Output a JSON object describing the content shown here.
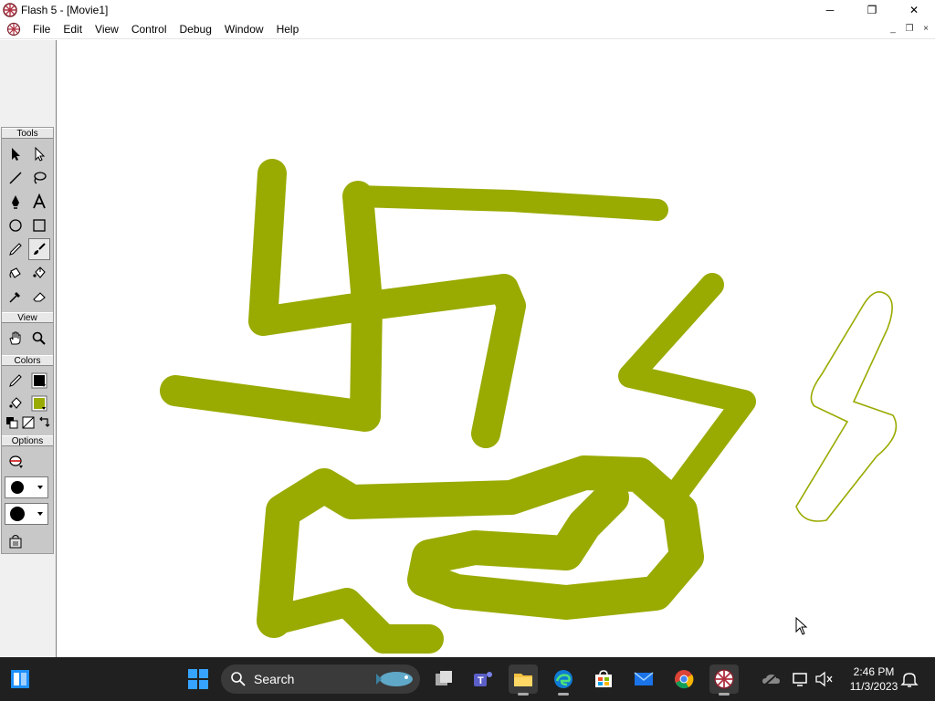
{
  "window": {
    "title": "Flash 5 - [Movie1]",
    "minimize_glyph": "─",
    "maximize_glyph": "❐",
    "close_glyph": "✕",
    "mdi_minimize_glyph": "_",
    "mdi_restore_glyph": "❐",
    "mdi_close_glyph": "×"
  },
  "menu": {
    "items": [
      "File",
      "Edit",
      "View",
      "Control",
      "Debug",
      "Window",
      "Help"
    ]
  },
  "toolbox": {
    "sections": {
      "tools": "Tools",
      "view": "View",
      "colors": "Colors",
      "options": "Options"
    },
    "tools": [
      {
        "name": "arrow-icon"
      },
      {
        "name": "subselect-icon"
      },
      {
        "name": "line-icon"
      },
      {
        "name": "lasso-icon"
      },
      {
        "name": "pen-icon"
      },
      {
        "name": "text-icon"
      },
      {
        "name": "oval-icon"
      },
      {
        "name": "rectangle-icon"
      },
      {
        "name": "pencil-icon"
      },
      {
        "name": "brush-icon"
      },
      {
        "name": "ink-bottle-icon"
      },
      {
        "name": "paint-bucket-icon"
      },
      {
        "name": "dropper-icon"
      },
      {
        "name": "eraser-icon"
      }
    ],
    "selected_tool": "brush-icon",
    "stroke_color": "#000000",
    "fill_color": "#99aa00"
  },
  "stage": {
    "paint_color": "#99aa00",
    "outline_color": "#99aa00",
    "background": "#ffffff"
  },
  "taskbar": {
    "search_placeholder": "Search",
    "time": "2:46 PM",
    "date": "11/3/2023",
    "background": "#202020"
  }
}
